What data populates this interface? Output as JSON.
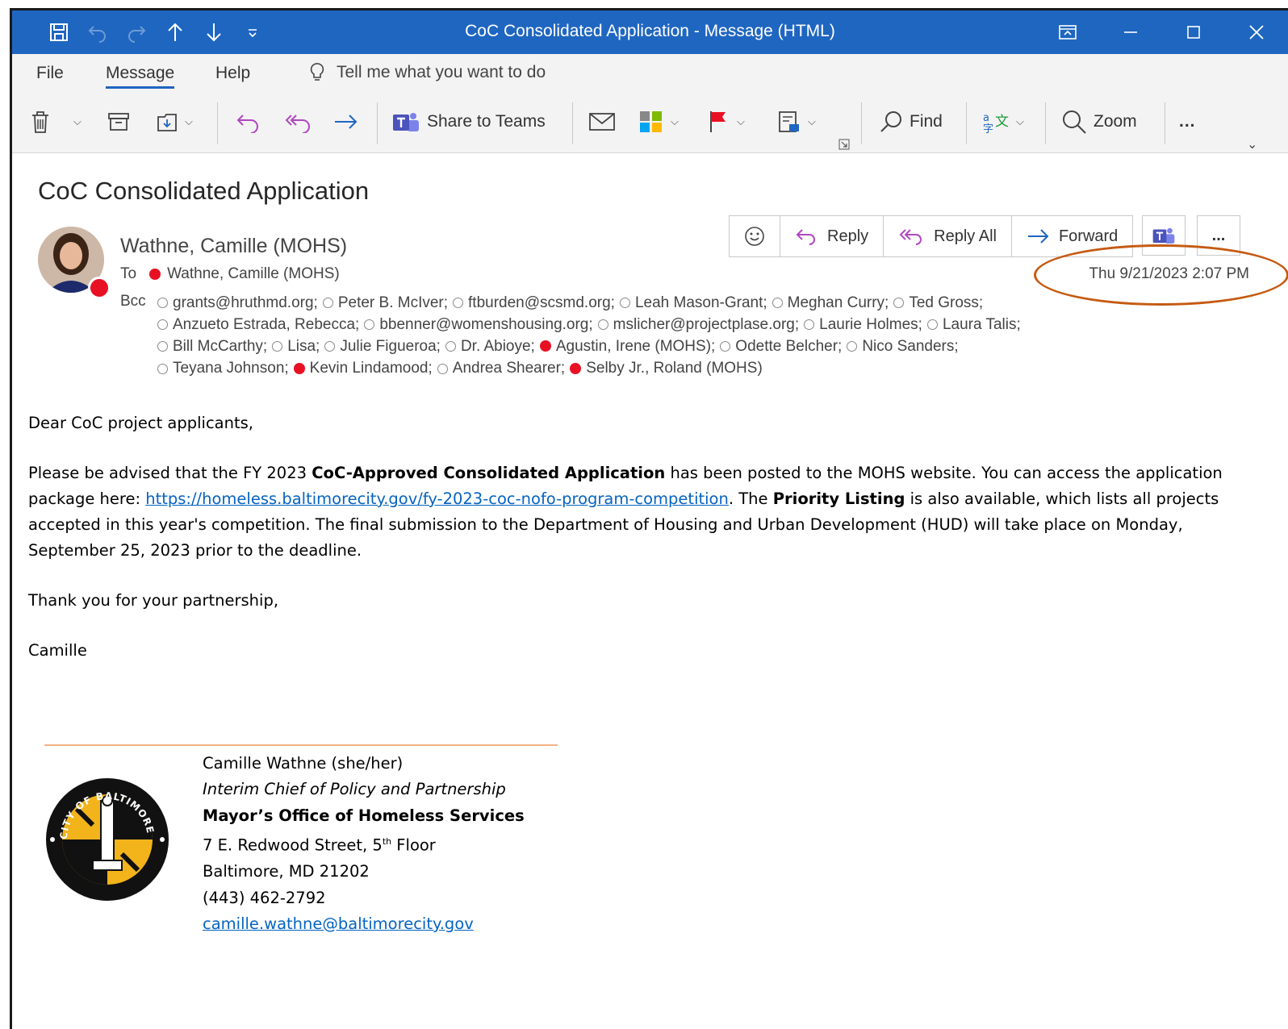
{
  "window": {
    "title": "CoC Consolidated Application  -  Message (HTML)",
    "accent_color": "#1f66c1"
  },
  "menu": {
    "file": "File",
    "message": "Message",
    "help": "Help",
    "tell_me": "Tell me what you want to do"
  },
  "ribbon": {
    "share_to_teams": "Share to Teams",
    "find": "Find",
    "zoom": "Zoom",
    "more": "..."
  },
  "message": {
    "subject": "CoC Consolidated Application",
    "sender": "Wathne, Camille (MOHS)",
    "to_label": "To",
    "to": "Wathne, Camille (MOHS)",
    "bcc_label": "Bcc",
    "date": "Thu 9/21/2023 2:07 PM",
    "actions": {
      "reply": "Reply",
      "reply_all": "Reply All",
      "forward": "Forward"
    },
    "bcc": [
      {
        "name": "grants@hruthmd.org;",
        "status": "unknown"
      },
      {
        "name": "Peter B. McIver;",
        "status": "unknown"
      },
      {
        "name": "ftburden@scsmd.org;",
        "status": "unknown"
      },
      {
        "name": "Leah Mason-Grant;",
        "status": "unknown"
      },
      {
        "name": "Meghan Curry;",
        "status": "unknown"
      },
      {
        "name": "Ted Gross;",
        "status": "unknown"
      },
      {
        "name": "Anzueto Estrada, Rebecca;",
        "status": "unknown"
      },
      {
        "name": "bbenner@womenshousing.org;",
        "status": "unknown"
      },
      {
        "name": "mslicher@projectplase.org;",
        "status": "unknown"
      },
      {
        "name": "Laurie Holmes;",
        "status": "unknown"
      },
      {
        "name": "Laura Talis;",
        "status": "unknown"
      },
      {
        "name": "Bill McCarthy;",
        "status": "unknown"
      },
      {
        "name": "Lisa;",
        "status": "unknown"
      },
      {
        "name": "Julie Figueroa;",
        "status": "unknown"
      },
      {
        "name": "Dr. Abioye;",
        "status": "unknown"
      },
      {
        "name": "Agustin, Irene (MOHS);",
        "status": "busy"
      },
      {
        "name": "Odette Belcher;",
        "status": "unknown"
      },
      {
        "name": "Nico Sanders;",
        "status": "unknown"
      },
      {
        "name": "Teyana Johnson;",
        "status": "unknown"
      },
      {
        "name": "Kevin Lindamood;",
        "status": "busy"
      },
      {
        "name": "Andrea Shearer;",
        "status": "unknown"
      },
      {
        "name": "Selby Jr., Roland (MOHS)",
        "status": "busy"
      }
    ],
    "body": {
      "greeting": "Dear CoC project applicants,",
      "p1_a": "Please be advised that the FY 2023 ",
      "p1_bold": "CoC-Approved Consolidated Application",
      "p1_b": " has been posted to the MOHS website. You can access the application package here: ",
      "p1_link": "https://homeless.baltimorecity.gov/fy-2023-coc-nofo-program-competition",
      "p1_c": ". The ",
      "p1_bold2": "Priority Listing",
      "p1_d": " is also available, which lists all projects accepted in this year's competition. The final submission to the Department of Housing and Urban Development (HUD) will take place on Monday, September 25, 2023 prior to the deadline.",
      "thanks": "Thank you for your partnership,",
      "signoff": "Camille"
    },
    "signature": {
      "name": "Camille Wathne (she/her)",
      "title": "Interim Chief of Policy and Partnership",
      "office": "Mayor’s Office of Homeless Services",
      "address_a": "7 E. Redwood Street, 5",
      "address_sup": "th",
      "address_b": " Floor",
      "city": "Baltimore, MD 21202",
      "phone": "(443) 462-2792",
      "email": "camille.wathne@baltimorecity.gov",
      "seal_text": "CITY OF BALTIMORE"
    }
  }
}
